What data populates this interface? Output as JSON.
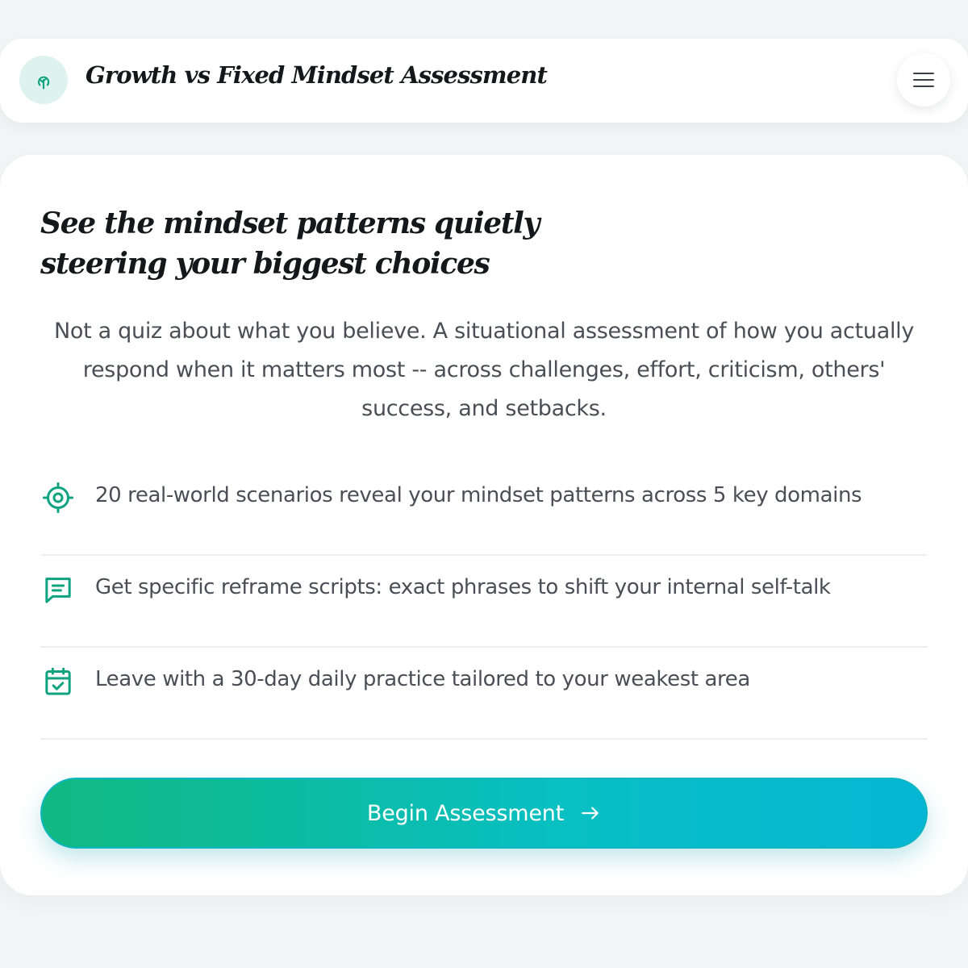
{
  "header": {
    "title": "Growth vs Fixed Mindset Assessment",
    "logo_icon": "tree-icon",
    "menu_icon": "hamburger-menu-icon"
  },
  "hero": {
    "headline": "See the mindset patterns quietly steering your biggest choices",
    "intro": "Not a quiz about what you believe. A situational assessment of how you actually respond when it matters most -- across challenges, effort, criticism, others' success, and setbacks."
  },
  "features": [
    {
      "icon": "target-icon",
      "text": "20 real-world scenarios reveal your mindset patterns across 5 key domains"
    },
    {
      "icon": "message-square-icon",
      "text": "Get specific reframe scripts: exact phrases to shift your internal self-talk"
    },
    {
      "icon": "calendar-check-icon",
      "text": "Leave with a 30-day daily practice tailored to your weakest area"
    }
  ],
  "cta": {
    "label": "Begin Assessment",
    "icon": "arrow-right-icon"
  },
  "colors": {
    "accent": "#10b981",
    "accent_end": "#06b6d4",
    "icon_green": "#10a37f",
    "text_dark": "#15171b",
    "text_muted": "#4a4f56"
  }
}
